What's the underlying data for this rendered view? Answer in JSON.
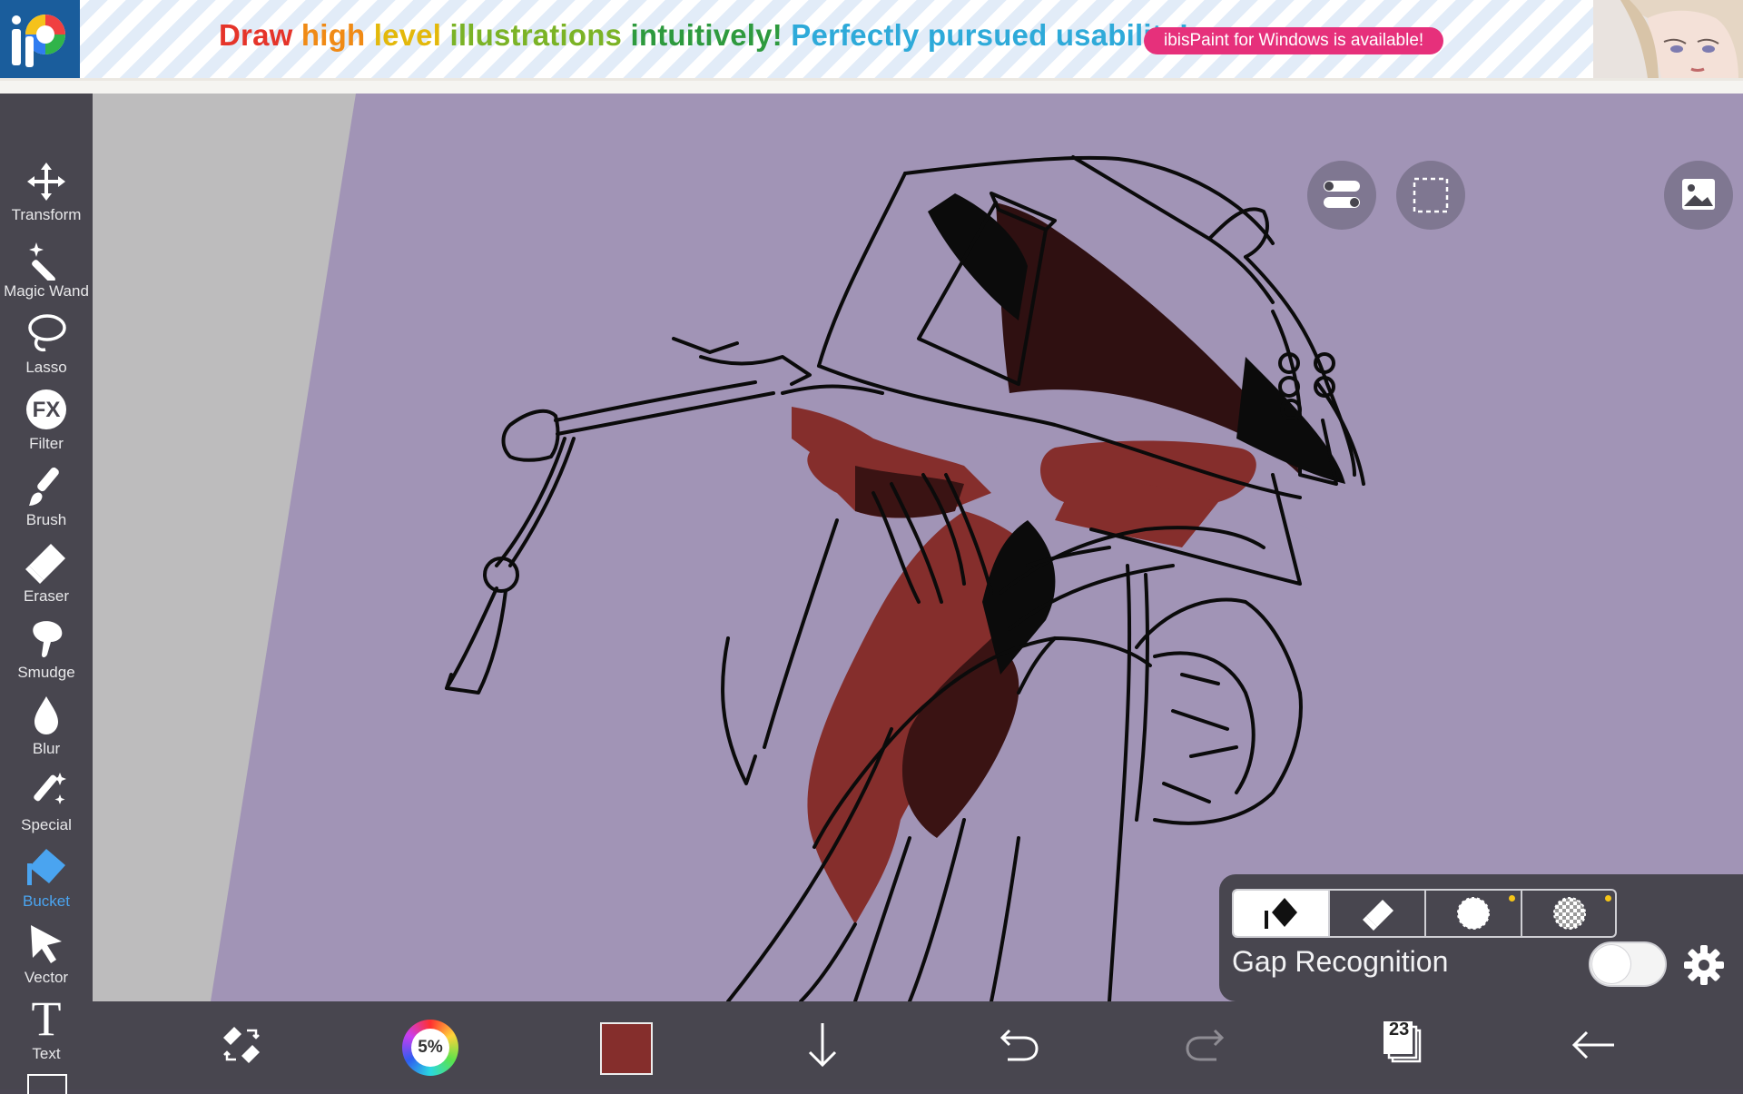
{
  "banner": {
    "headline_words": [
      "Draw",
      "high",
      "level",
      "illustrations",
      "intuitively!",
      "Perfectly pursued usability!"
    ],
    "promo_button": "ibisPaint for Windows is available!",
    "logo_icon": "ibispaint-logo-icon"
  },
  "toolbar": {
    "tools": [
      {
        "label": "Transform",
        "icon": "move-arrows-icon"
      },
      {
        "label": "Magic Wand",
        "icon": "magic-wand-icon"
      },
      {
        "label": "Lasso",
        "icon": "lasso-icon"
      },
      {
        "label": "Filter",
        "icon": "fx-icon",
        "glyph": "FX"
      },
      {
        "label": "Brush",
        "icon": "brush-icon"
      },
      {
        "label": "Eraser",
        "icon": "eraser-icon"
      },
      {
        "label": "Smudge",
        "icon": "smudge-icon"
      },
      {
        "label": "Blur",
        "icon": "drop-icon"
      },
      {
        "label": "Special",
        "icon": "sparkle-pen-icon"
      },
      {
        "label": "Bucket",
        "icon": "bucket-icon",
        "active": true
      },
      {
        "label": "Vector",
        "icon": "cursor-arrow-icon"
      },
      {
        "label": "Text",
        "icon": "text-t-icon",
        "glyph": "T"
      }
    ],
    "active_color": "#4aa4f0"
  },
  "canvas": {
    "background_color": "#a194b6",
    "margin_color": "#bdbdbd",
    "overlay_icons": [
      "toggle-options-icon",
      "selection-rect-icon",
      "reference-image-icon"
    ]
  },
  "bucket_panel": {
    "modes": [
      "fill-mode-icon",
      "erase-fill-mode-icon",
      "circle-mode-icon",
      "transparent-mode-icon"
    ],
    "selected_mode": 0,
    "gap_label": "Gap Recognition",
    "gap_enabled": false
  },
  "bottombar": {
    "brush_opacity_label": "5%",
    "current_color": "#852e2c",
    "layer_count": "23",
    "icons": [
      "tool-swap-icon",
      "color-wheel-icon",
      "color-swatch",
      "down-arrow-icon",
      "undo-icon",
      "redo-icon",
      "layers-icon",
      "back-arrow-icon"
    ]
  }
}
